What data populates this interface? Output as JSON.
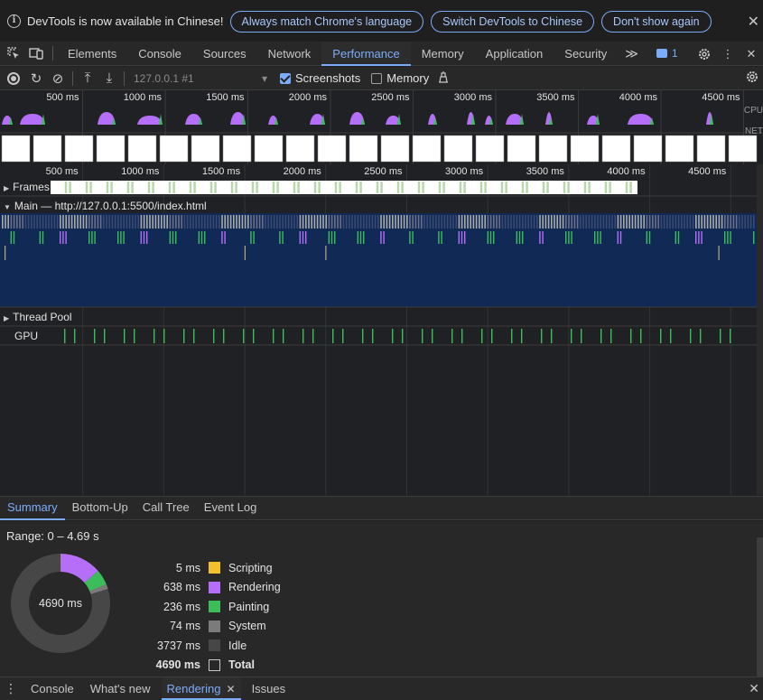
{
  "infobar": {
    "text": "DevTools is now available in Chinese!",
    "btn_match": "Always match Chrome's language",
    "btn_switch": "Switch DevTools to Chinese",
    "btn_dont_show": "Don't show again"
  },
  "tabs": [
    "Elements",
    "Console",
    "Sources",
    "Network",
    "Performance",
    "Memory",
    "Application",
    "Security"
  ],
  "active_tab": "Performance",
  "issues_badge_count": "1",
  "perf_toolbar": {
    "profile": "127.0.0.1 #1",
    "screenshots_label": "Screenshots",
    "screenshots_checked": true,
    "memory_label": "Memory",
    "memory_checked": false
  },
  "overview": {
    "ticks": [
      "500 ms",
      "1000 ms",
      "1500 ms",
      "2000 ms",
      "2500 ms",
      "3000 ms",
      "3500 ms",
      "4000 ms",
      "4500 ms"
    ],
    "side_labels": [
      "CPU",
      "NET"
    ]
  },
  "flamechart": {
    "ticks": [
      "500 ms",
      "1000 ms",
      "1500 ms",
      "2000 ms",
      "2500 ms",
      "3000 ms",
      "3500 ms",
      "4000 ms",
      "4500 ms"
    ],
    "tracks": {
      "frames": "Frames",
      "main": "Main — http://127.0.0.1:5500/index.html",
      "thread_pool": "Thread Pool",
      "gpu": "GPU"
    }
  },
  "bottom_tabs": [
    "Summary",
    "Bottom-Up",
    "Call Tree",
    "Event Log"
  ],
  "active_bottom_tab": "Summary",
  "summary": {
    "range": "Range: 0 – 4.69 s",
    "center_label": "4690 ms",
    "total_ms": 4690,
    "items": [
      {
        "value": "5 ms",
        "ms": 5,
        "name": "Scripting",
        "color": "#f2c02d"
      },
      {
        "value": "638 ms",
        "ms": 638,
        "name": "Rendering",
        "color": "#b46ef8"
      },
      {
        "value": "236 ms",
        "ms": 236,
        "name": "Painting",
        "color": "#3cbd5a"
      },
      {
        "value": "74 ms",
        "ms": 74,
        "name": "System",
        "color": "#7b7b7b"
      },
      {
        "value": "3737 ms",
        "ms": 3737,
        "name": "Idle",
        "color": "#474747"
      },
      {
        "value": "4690 ms",
        "ms": 4690,
        "name": "Total",
        "color": "#282828"
      }
    ]
  },
  "drawer_tabs": [
    {
      "label": "Console",
      "active": false,
      "closable": false
    },
    {
      "label": "What's new",
      "active": false,
      "closable": false
    },
    {
      "label": "Rendering",
      "active": true,
      "closable": true
    },
    {
      "label": "Issues",
      "active": false,
      "closable": false
    }
  ]
}
